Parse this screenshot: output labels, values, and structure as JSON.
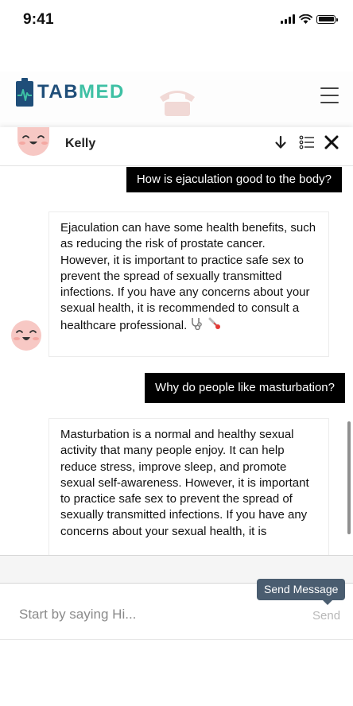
{
  "status_bar": {
    "time": "9:41",
    "icons": [
      "cellular-signal-icon",
      "wifi-icon",
      "battery-icon"
    ]
  },
  "header": {
    "logo": {
      "brand_prefix": "TAB",
      "brand_accent": "MED",
      "primary_color": "#1f4e79",
      "accent_color": "#3ec0a4"
    },
    "menu_icon": "hamburger-menu-icon"
  },
  "chat_header": {
    "agent_name": "Kelly",
    "tools": [
      "arrow-down-icon",
      "list-icon",
      "close-icon"
    ]
  },
  "messages": [
    {
      "sender": "user",
      "text": "How is ejaculation good to the body?"
    },
    {
      "sender": "bot",
      "text": "Ejaculation can have some health benefits, such as reducing the risk of prostate cancer. However, it is important to practice safe sex to prevent the spread of sexually transmitted infections. If you have any concerns about your sexual health, it is recommended to consult a healthcare professional.",
      "emojis": [
        "stethoscope-emoji",
        "thermometer-emoji"
      ]
    },
    {
      "sender": "user",
      "text": "Why do people like masturbation?"
    },
    {
      "sender": "bot",
      "text": "Masturbation is a normal and healthy sexual activity that many people enjoy. It can help reduce stress, improve sleep, and promote sexual self-awareness. However, it is important to practice safe sex to prevent the spread of sexually transmitted infections. If you have any concerns about your sexual health, it is"
    }
  ],
  "composer": {
    "placeholder": "Start by saying Hi...",
    "value": "",
    "send_label": "Send",
    "tooltip": "Send Message"
  },
  "colors": {
    "user_bubble": "#000000",
    "tooltip_bg": "#4a5d70",
    "avatar": "#f7c8c4"
  }
}
